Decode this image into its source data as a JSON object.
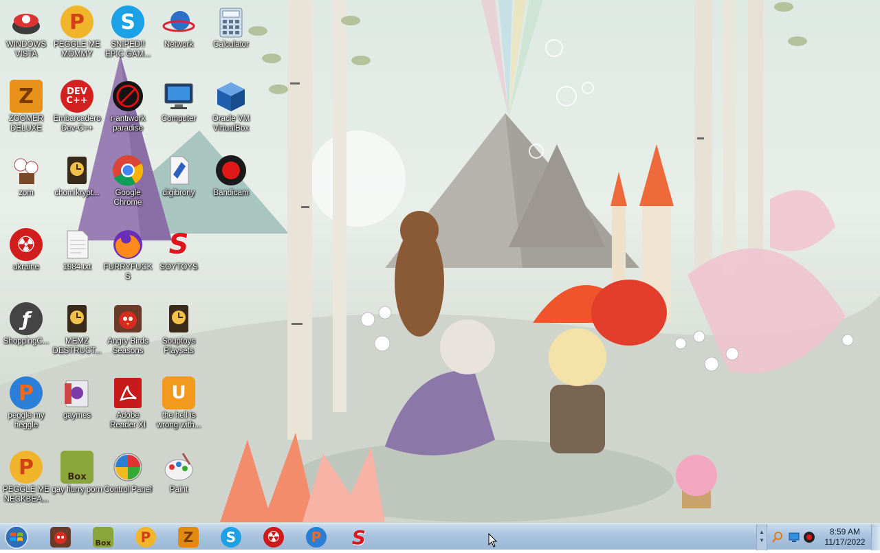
{
  "desktop": {
    "icons": [
      {
        "label": "WINDOWS VISTA",
        "icon": "windows-vista-icon"
      },
      {
        "label": "PEGGLE ME MOMMY",
        "icon": "peggle-icon"
      },
      {
        "label": "SNIPED!! EPIC GAM...",
        "icon": "skype-icon"
      },
      {
        "label": "Network",
        "icon": "network-icon"
      },
      {
        "label": "Calculator",
        "icon": "calculator-icon"
      },
      {
        "label": "ZOOMER DELUXE",
        "icon": "zoomer-icon"
      },
      {
        "label": "Embarcadero Dev-C++",
        "icon": "devcpp-icon"
      },
      {
        "label": "r-antiwork paradise",
        "icon": "antiwork-icon"
      },
      {
        "label": "Computer",
        "icon": "computer-icon"
      },
      {
        "label": "Oracle VM VirtualBox",
        "icon": "virtualbox-icon"
      },
      {
        "label": "zom",
        "icon": "zom-icon"
      },
      {
        "label": "chomikrypt...",
        "icon": "chomikrypt-icon"
      },
      {
        "label": "Google Chrome",
        "icon": "chrome-icon"
      },
      {
        "label": "digibrony",
        "icon": "digibrony-icon"
      },
      {
        "label": "Bandicam",
        "icon": "bandicam-icon"
      },
      {
        "label": "ukraine",
        "icon": "radiation-icon"
      },
      {
        "label": "1984.txt",
        "icon": "text-file-icon"
      },
      {
        "label": "FURRYFUCKS",
        "icon": "firefox-icon"
      },
      {
        "label": "SOYTOYS",
        "icon": "soytoys-icon"
      },
      {
        "label": "ShoppingC...",
        "icon": "flash-icon"
      },
      {
        "label": "MEMZ DESTRUCT...",
        "icon": "memz-icon"
      },
      {
        "label": "Angry Birds Seasons",
        "icon": "angry-birds-icon"
      },
      {
        "label": "Souptoys Playsets",
        "icon": "souptoys-icon"
      },
      {
        "label": "peggle my heggle",
        "icon": "peggle-icon"
      },
      {
        "label": "gaymes",
        "icon": "gaymes-icon"
      },
      {
        "label": "Adobe Reader XI",
        "icon": "adobe-reader-icon"
      },
      {
        "label": "the hell is wrong with...",
        "icon": "uc-browser-icon"
      },
      {
        "label": "PEGGLE ME NECKBEA...",
        "icon": "peggle-icon"
      },
      {
        "label": "gay fiurry porn",
        "icon": "box-icon"
      },
      {
        "label": "Control Panel",
        "icon": "control-panel-icon"
      },
      {
        "label": "Paint",
        "icon": "paint-icon"
      }
    ]
  },
  "taskbar": {
    "start_icon": "windows-start-icon",
    "pinned": [
      {
        "icon": "angry-birds-icon",
        "color": "#7a3b2a",
        "glyph": "🐦"
      },
      {
        "icon": "box-icon",
        "color": "#7a8a3a",
        "glyph": "Box"
      },
      {
        "icon": "peggle-icon",
        "color": "#e25a1c",
        "glyph": "P"
      },
      {
        "icon": "zoomer-icon",
        "color": "#e08a12",
        "glyph": "Z"
      },
      {
        "icon": "skype-icon",
        "color": "#1fa0e3",
        "glyph": "S"
      },
      {
        "icon": "radiation-icon",
        "color": "#cc1b1b",
        "glyph": "☢"
      },
      {
        "icon": "peggle-icon",
        "color": "#2a7fd4",
        "glyph": "P"
      },
      {
        "icon": "soytoys-icon",
        "color": "#e0141a",
        "glyph": "S"
      }
    ],
    "tray": {
      "icons": [
        "search-tray-icon",
        "network-tray-icon",
        "bandicam-tray-icon"
      ],
      "time": "8:59 AM",
      "date": "11/17/2022"
    }
  }
}
